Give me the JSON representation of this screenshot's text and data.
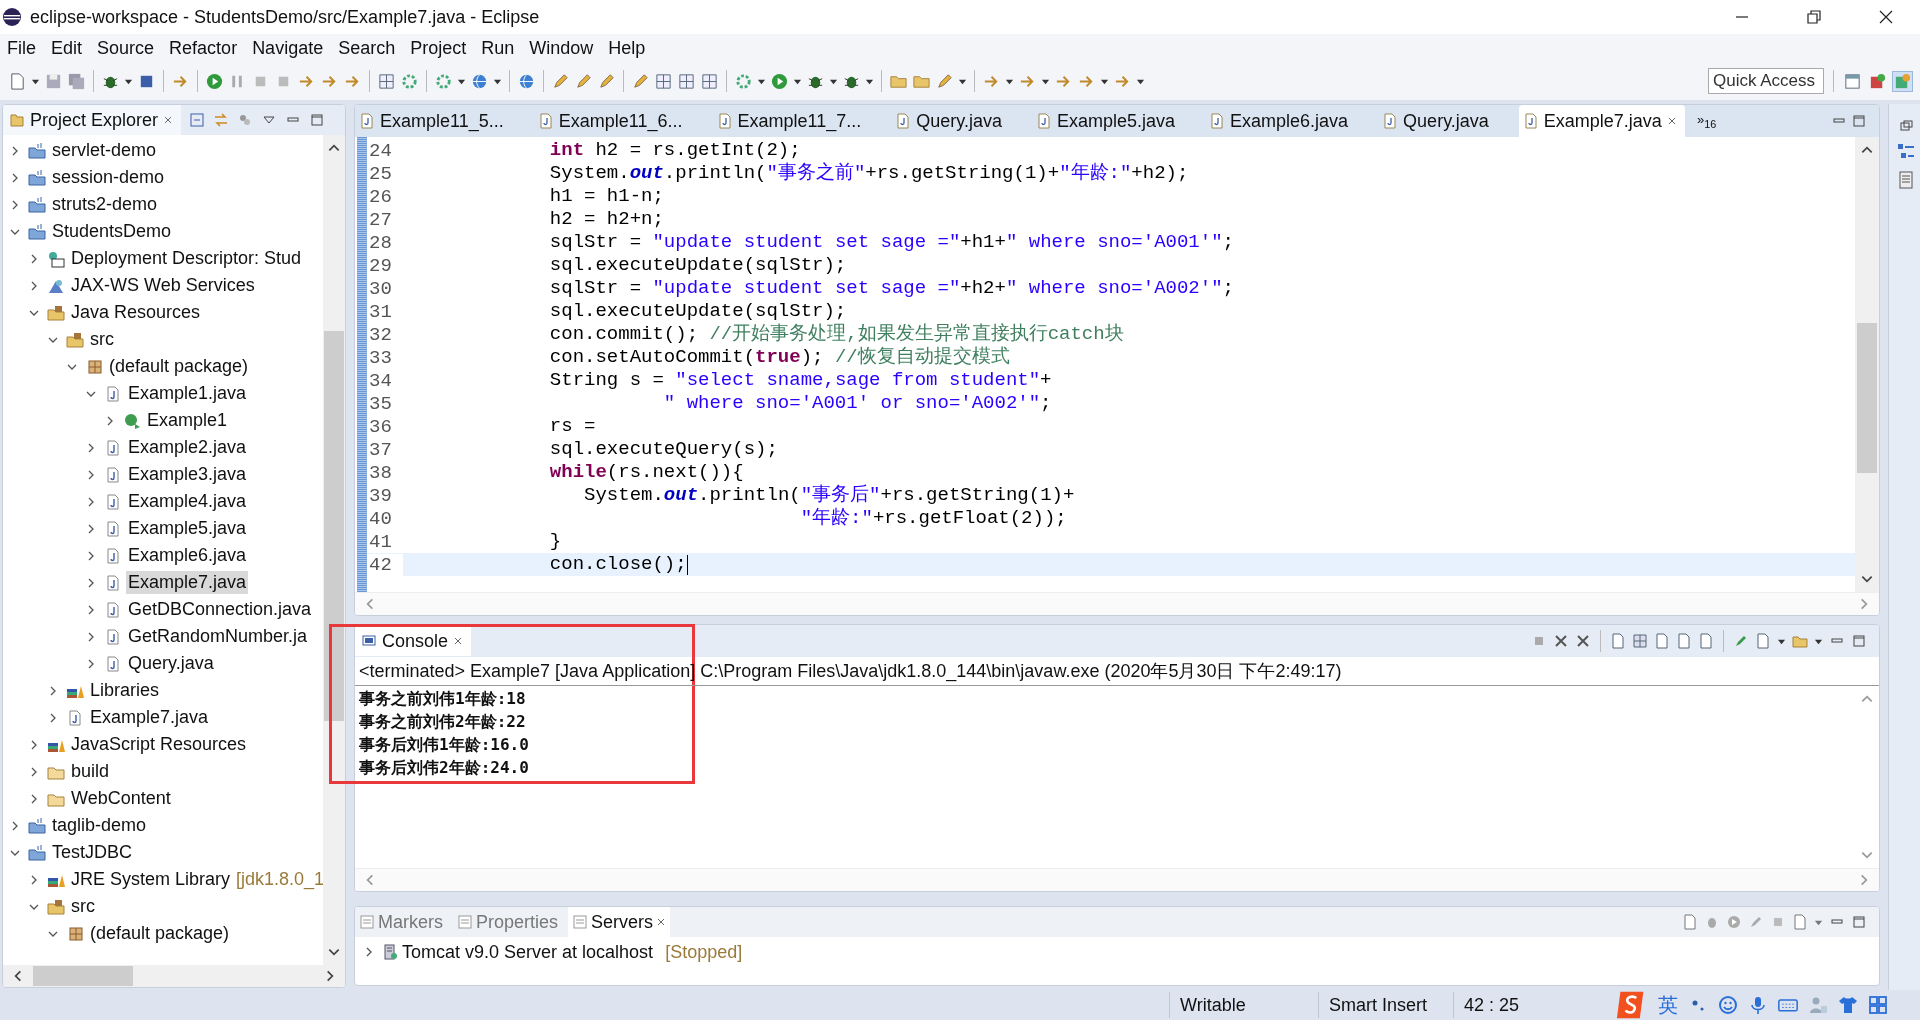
{
  "window": {
    "title": "eclipse-workspace - StudentsDemo/src/Example7.java - Eclipse"
  },
  "menu": [
    "File",
    "Edit",
    "Source",
    "Refactor",
    "Navigate",
    "Search",
    "Project",
    "Run",
    "Window",
    "Help"
  ],
  "quick_access": {
    "placeholder": "Quick Access"
  },
  "project_explorer": {
    "title": "Project Explorer",
    "items": [
      {
        "label": "servlet-demo",
        "kind": "project",
        "expanded": false,
        "selected": false
      },
      {
        "label": "session-demo",
        "kind": "project",
        "expanded": false,
        "selected": false
      },
      {
        "label": "struts2-demo",
        "kind": "project",
        "expanded": false,
        "selected": false
      },
      {
        "label": "StudentsDemo",
        "kind": "project",
        "expanded": true,
        "selected": false,
        "children": [
          {
            "label": "Deployment Descriptor: Stud",
            "kind": "descriptor",
            "expanded": false,
            "selected": false
          },
          {
            "label": "JAX-WS Web Services",
            "kind": "webservice",
            "expanded": false,
            "selected": false
          },
          {
            "label": "Java Resources",
            "kind": "resources",
            "expanded": true,
            "selected": false,
            "children": [
              {
                "label": "src",
                "kind": "srcfolder",
                "expanded": true,
                "selected": false,
                "children": [
                  {
                    "label": "(default package)",
                    "kind": "package",
                    "expanded": true,
                    "selected": false,
                    "children": [
                      {
                        "label": "Example1.java",
                        "kind": "java",
                        "expanded": true,
                        "selected": false,
                        "children": [
                          {
                            "label": "Example1",
                            "kind": "class",
                            "expanded": false,
                            "selected": false
                          }
                        ]
                      },
                      {
                        "label": "Example2.java",
                        "kind": "java",
                        "expanded": false,
                        "selected": false
                      },
                      {
                        "label": "Example3.java",
                        "kind": "java",
                        "expanded": false,
                        "selected": false
                      },
                      {
                        "label": "Example4.java",
                        "kind": "java",
                        "expanded": false,
                        "selected": false
                      },
                      {
                        "label": "Example5.java",
                        "kind": "java",
                        "expanded": false,
                        "selected": false
                      },
                      {
                        "label": "Example6.java",
                        "kind": "java",
                        "expanded": false,
                        "selected": false
                      },
                      {
                        "label": "Example7.java",
                        "kind": "java",
                        "expanded": false,
                        "selected": true
                      },
                      {
                        "label": "GetDBConnection.java",
                        "kind": "java",
                        "expanded": false,
                        "selected": false
                      },
                      {
                        "label": "GetRandomNumber.ja",
                        "kind": "java",
                        "expanded": false,
                        "selected": false
                      },
                      {
                        "label": "Query.java",
                        "kind": "java",
                        "expanded": false,
                        "selected": false
                      }
                    ]
                  }
                ]
              },
              {
                "label": "Libraries",
                "kind": "library",
                "expanded": false,
                "selected": false
              },
              {
                "label": "Example7.java",
                "kind": "java",
                "expanded": false,
                "selected": false
              }
            ]
          },
          {
            "label": "JavaScript Resources",
            "kind": "library",
            "expanded": false,
            "selected": false
          },
          {
            "label": "build",
            "kind": "folder",
            "expanded": false,
            "selected": false
          },
          {
            "label": "WebContent",
            "kind": "folder",
            "expanded": false,
            "selected": false
          }
        ]
      },
      {
        "label": "taglib-demo",
        "kind": "project",
        "expanded": false,
        "selected": false
      },
      {
        "label": "TestJDBC",
        "kind": "project",
        "expanded": true,
        "selected": false,
        "children": [
          {
            "label": "JRE System Library",
            "decoration": "[jdk1.8.0_1",
            "kind": "library",
            "expanded": false,
            "selected": false
          },
          {
            "label": "src",
            "kind": "srcfolder",
            "expanded": true,
            "selected": false,
            "children": [
              {
                "label": "(default package)",
                "kind": "package",
                "expanded": true,
                "selected": false
              }
            ]
          }
        ]
      }
    ]
  },
  "editor": {
    "tabs": [
      {
        "label": "Example11_5...",
        "selected": false
      },
      {
        "label": "Example11_6...",
        "selected": false
      },
      {
        "label": "Example11_7...",
        "selected": false
      },
      {
        "label": "Query.java",
        "selected": false
      },
      {
        "label": "Example5.java",
        "selected": false
      },
      {
        "label": "Example6.java",
        "selected": false
      },
      {
        "label": "Query.java",
        "selected": false
      },
      {
        "label": "Example7.java",
        "selected": true
      }
    ],
    "overflow": "»$_{16}$",
    "lines": [
      {
        "number": "24",
        "current": false,
        "segments": [
          {
            "kind": "keyword",
            "text": "            int"
          },
          {
            "kind": "plain",
            "text": " h2 = rs.getInt(2);"
          }
        ]
      },
      {
        "number": "25",
        "current": false,
        "segments": [
          {
            "kind": "plain",
            "text": "            System."
          },
          {
            "kind": "field",
            "text": "out"
          },
          {
            "kind": "plain",
            "text": ".println("
          },
          {
            "kind": "string",
            "text": "\"事务之前\""
          },
          {
            "kind": "plain",
            "text": "+rs.getString(1)+"
          },
          {
            "kind": "string",
            "text": "\"年龄:\""
          },
          {
            "kind": "plain",
            "text": "+h2);"
          }
        ]
      },
      {
        "number": "26",
        "current": false,
        "segments": [
          {
            "kind": "plain",
            "text": "            h1 = h1-n;"
          }
        ]
      },
      {
        "number": "27",
        "current": false,
        "segments": [
          {
            "kind": "plain",
            "text": "            h2 = h2+n;"
          }
        ]
      },
      {
        "number": "28",
        "current": false,
        "segments": [
          {
            "kind": "plain",
            "text": "            sqlStr = "
          },
          {
            "kind": "string",
            "text": "\"update student set sage =\""
          },
          {
            "kind": "plain",
            "text": "+h1+"
          },
          {
            "kind": "string",
            "text": "\" where sno='A001'\""
          },
          {
            "kind": "plain",
            "text": ";"
          }
        ]
      },
      {
        "number": "29",
        "current": false,
        "segments": [
          {
            "kind": "plain",
            "text": "            sql.executeUpdate(sqlStr);"
          }
        ]
      },
      {
        "number": "30",
        "current": false,
        "segments": [
          {
            "kind": "plain",
            "text": "            sqlStr = "
          },
          {
            "kind": "string",
            "text": "\"update student set sage =\""
          },
          {
            "kind": "plain",
            "text": "+h2+"
          },
          {
            "kind": "string",
            "text": "\" where sno='A002'\""
          },
          {
            "kind": "plain",
            "text": ";"
          }
        ]
      },
      {
        "number": "31",
        "current": false,
        "segments": [
          {
            "kind": "plain",
            "text": "            sql.executeUpdate(sqlStr);"
          }
        ]
      },
      {
        "number": "32",
        "current": false,
        "segments": [
          {
            "kind": "plain",
            "text": "            con.commit(); "
          },
          {
            "kind": "comment",
            "text": "//开始事务处理,如果发生异常直接执行catch块"
          }
        ]
      },
      {
        "number": "33",
        "current": false,
        "segments": [
          {
            "kind": "plain",
            "text": "            con.setAutoCommit("
          },
          {
            "kind": "keyword",
            "text": "true"
          },
          {
            "kind": "plain",
            "text": "); "
          },
          {
            "kind": "comment",
            "text": "//恢复自动提交模式"
          }
        ]
      },
      {
        "number": "34",
        "current": false,
        "segments": [
          {
            "kind": "plain",
            "text": "            String s = "
          },
          {
            "kind": "string",
            "text": "\"select sname,sage from student\""
          },
          {
            "kind": "plain",
            "text": "+"
          }
        ]
      },
      {
        "number": "35",
        "current": false,
        "segments": [
          {
            "kind": "string",
            "text": "                      \" where sno='A001' or sno='A002'\""
          },
          {
            "kind": "plain",
            "text": ";"
          }
        ]
      },
      {
        "number": "36",
        "current": false,
        "segments": [
          {
            "kind": "plain",
            "text": "            rs ="
          }
        ]
      },
      {
        "number": "37",
        "current": false,
        "segments": [
          {
            "kind": "plain",
            "text": "            sql.executeQuery(s);"
          }
        ]
      },
      {
        "number": "38",
        "current": false,
        "segments": [
          {
            "kind": "keyword",
            "text": "            while"
          },
          {
            "kind": "plain",
            "text": "(rs.next()){"
          }
        ]
      },
      {
        "number": "39",
        "current": false,
        "segments": [
          {
            "kind": "plain",
            "text": "               System."
          },
          {
            "kind": "field",
            "text": "out"
          },
          {
            "kind": "plain",
            "text": ".println("
          },
          {
            "kind": "string",
            "text": "\"事务后\""
          },
          {
            "kind": "plain",
            "text": "+rs.getString(1)+"
          }
        ]
      },
      {
        "number": "40",
        "current": false,
        "segments": [
          {
            "kind": "string",
            "text": "                                  \"年龄:\""
          },
          {
            "kind": "plain",
            "text": "+rs.getFloat(2));"
          }
        ]
      },
      {
        "number": "41",
        "current": false,
        "segments": [
          {
            "kind": "plain",
            "text": "            }"
          }
        ]
      },
      {
        "number": "42",
        "current": true,
        "segments": [
          {
            "kind": "plain",
            "text": "            con.close();"
          }
        ]
      }
    ]
  },
  "console": {
    "title": "Console",
    "status": "<terminated> Example7 [Java Application] C:\\Program Files\\Java\\jdk1.8.0_144\\bin\\javaw.exe (2020年5月30日 下午2:49:17)",
    "lines": [
      "事务之前刘伟1年龄:18",
      "事务之前刘伟2年龄:22",
      "事务后刘伟1年龄:16.0",
      "事务后刘伟2年龄:24.0"
    ]
  },
  "servers_panel": {
    "tabs": [
      {
        "label": "Markers",
        "selected": false
      },
      {
        "label": "Properties",
        "selected": false
      },
      {
        "label": "Servers",
        "selected": true
      }
    ],
    "rows": [
      {
        "name": "Tomcat v9.0 Server at localhost",
        "state": "[Stopped]"
      }
    ]
  },
  "status_bar": [
    "Writable",
    "Smart Insert",
    "42 : 25"
  ],
  "ime": {
    "mode": "英"
  }
}
